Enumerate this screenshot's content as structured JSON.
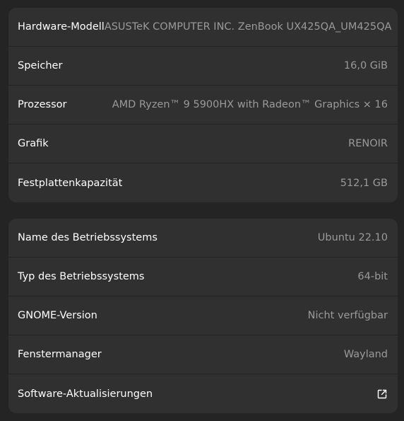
{
  "hardware": {
    "rows": [
      {
        "label": "Hardware-Modell",
        "value": "ASUSTeK COMPUTER INC. ZenBook UX425QA_UM425QA"
      },
      {
        "label": "Speicher",
        "value": "16,0 GiB"
      },
      {
        "label": "Prozessor",
        "value": "AMD Ryzen™ 9 5900HX with Radeon™ Graphics × 16"
      },
      {
        "label": "Grafik",
        "value": "RENOIR"
      },
      {
        "label": "Festplattenkapazität",
        "value": "512,1 GB"
      }
    ]
  },
  "system": {
    "rows": [
      {
        "label": "Name des Betriebssystems",
        "value": "Ubuntu 22.10"
      },
      {
        "label": "Typ des Betriebssystems",
        "value": "64-bit"
      },
      {
        "label": "GNOME-Version",
        "value": "Nicht verfügbar"
      },
      {
        "label": "Fenstermanager",
        "value": "Wayland"
      }
    ],
    "updates": {
      "label": "Software-Aktualisierungen",
      "icon": "external-link-icon"
    }
  }
}
